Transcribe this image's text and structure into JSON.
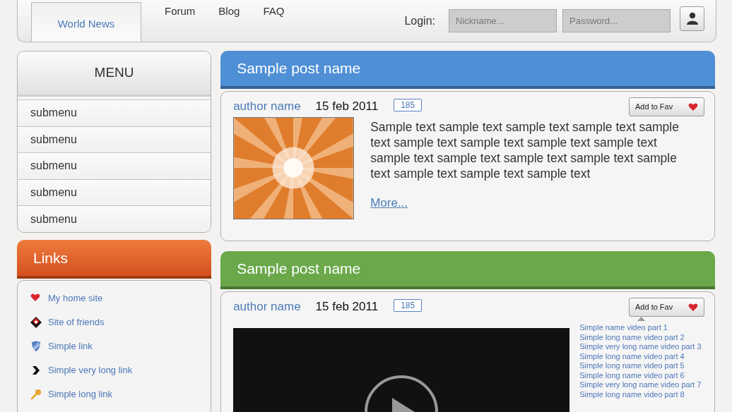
{
  "nav": {
    "tabs": [
      {
        "label": "World News",
        "selected": true
      },
      {
        "label": "Forum",
        "selected": false
      },
      {
        "label": "Blog",
        "selected": false
      },
      {
        "label": "FAQ",
        "selected": false
      }
    ],
    "login": {
      "label": "Login:",
      "nickname_placeholder": "Nickname...",
      "password_placeholder": "Password..."
    }
  },
  "menu": {
    "title": "MENU",
    "items": [
      "submenu",
      "submenu",
      "submenu",
      "submenu",
      "submenu"
    ]
  },
  "links": {
    "title": "Links",
    "items": [
      "My home site",
      "Site of friends",
      "Simple link",
      "Simple very long link",
      "Simple long link"
    ]
  },
  "posts": [
    {
      "title": "Sample post name",
      "color": "#4f8fd6",
      "author": "author name",
      "date": "15 feb 2011",
      "comments": "185",
      "fav_label": "Add to Fav",
      "text": "Sample text sample text sample text sample text sample text sample text sample text sample text sample text sample text sample text sample text sample text sample text sample text sample text sample text",
      "more": "More..."
    },
    {
      "kind": "video",
      "title": "Sample post name",
      "color": "#6aa84a",
      "author": "author name",
      "date": "15 feb 2011",
      "comments": "185",
      "fav_label": "Add to Fav",
      "playlist": [
        "Simple name video part 1",
        "Simple long name video part 2",
        "Simple very long name video part 3",
        "Simple long name video part 4",
        "Simple long name video part 5",
        "Simple long name video part 6",
        "Simple very long name video part 7",
        "Simple long name video part 8"
      ]
    }
  ]
}
